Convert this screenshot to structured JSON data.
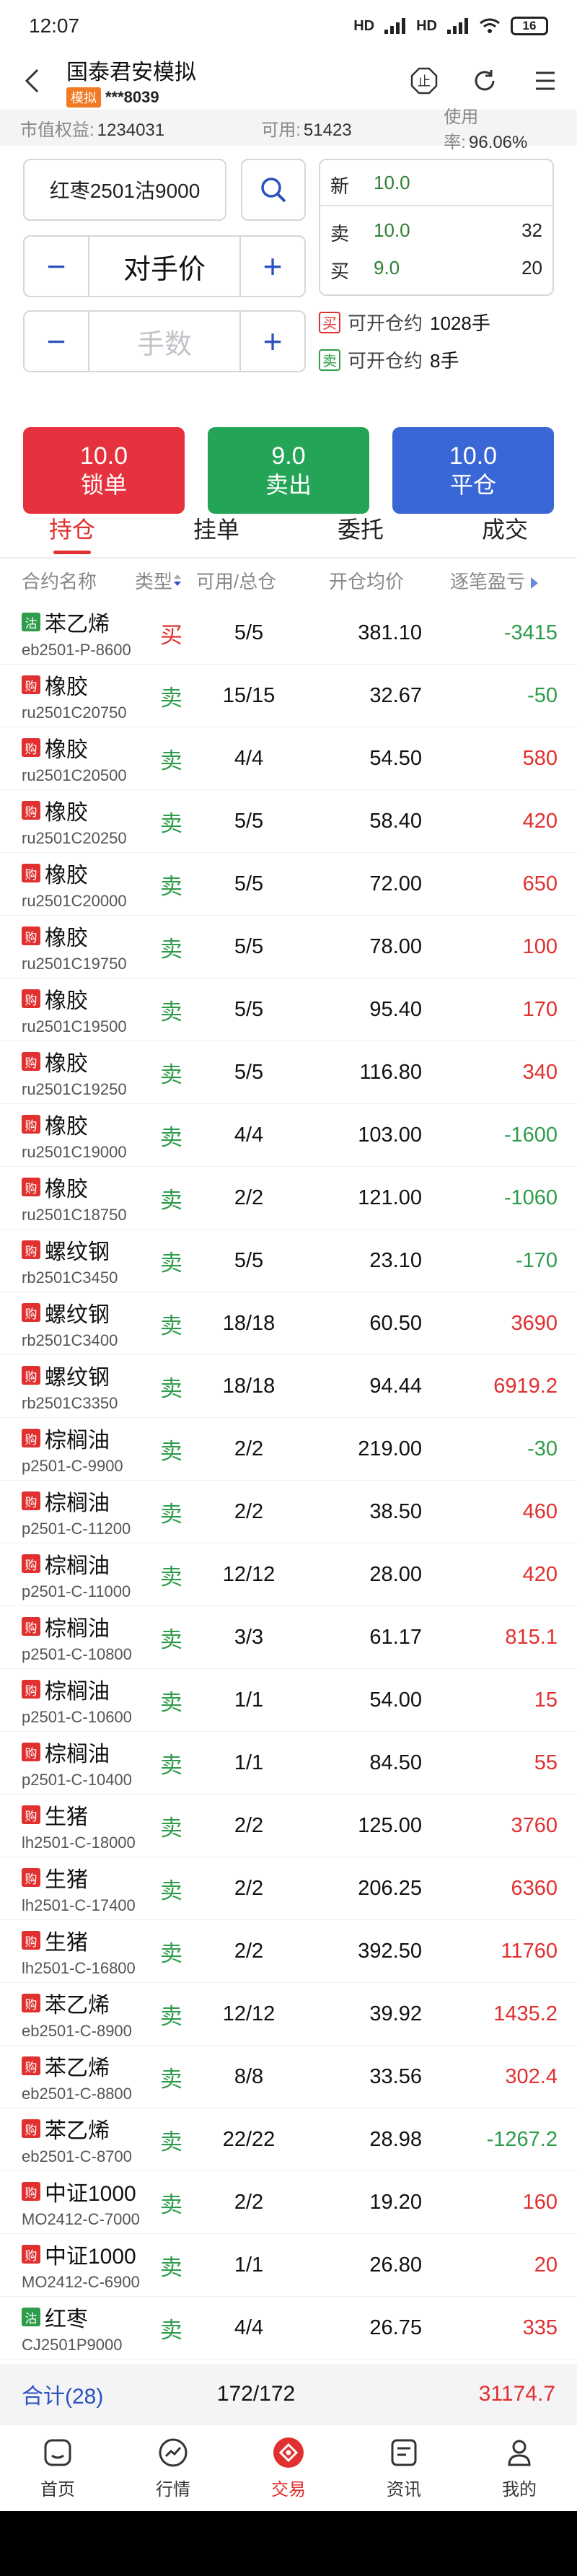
{
  "status": {
    "time": "12:07",
    "net1": "HD",
    "net2": "HD",
    "battery": "16"
  },
  "header": {
    "title": "国泰君安模拟",
    "tag": "模拟",
    "account": "***8039"
  },
  "summary": {
    "equity_label": "市值权益:",
    "equity_value": "1234031",
    "available_label": "可用:",
    "available_value": "51423",
    "usage_label": "使用率:",
    "usage_value": "96.06%"
  },
  "order": {
    "contract": "红枣2501沽9000",
    "price_mode": "对手价",
    "qty_placeholder": "手数",
    "minus": "−",
    "plus": "+"
  },
  "quote": {
    "last_label": "新",
    "last_price": "10.0",
    "ask_label": "卖",
    "ask_price": "10.0",
    "ask_vol": "32",
    "bid_label": "买",
    "bid_price": "9.0",
    "bid_vol": "20"
  },
  "open_info": {
    "buy_tag": "买",
    "buy_label": "可开仓约",
    "buy_value": "1028手",
    "sell_tag": "卖",
    "sell_label": "可开仓约",
    "sell_value": "8手"
  },
  "actions": [
    {
      "price": "10.0",
      "label": "锁单",
      "color": "#e5323e"
    },
    {
      "price": "9.0",
      "label": "卖出",
      "color": "#23a457"
    },
    {
      "price": "10.0",
      "label": "平仓",
      "color": "#3a67d6"
    }
  ],
  "tabs": [
    "持仓",
    "挂单",
    "委托",
    "成交"
  ],
  "columns": {
    "name": "合约名称",
    "type": "类型",
    "avail": "可用/总仓",
    "price": "开仓均价",
    "pnl": "逐笔盈亏"
  },
  "rows": [
    {
      "badge": "沽",
      "name": "苯乙烯",
      "code": "eb2501-P-8600",
      "type": "买",
      "avail": "5/5",
      "price": "381.10",
      "pnl": "-3415"
    },
    {
      "badge": "购",
      "name": "橡胶",
      "code": "ru2501C20750",
      "type": "卖",
      "avail": "15/15",
      "price": "32.67",
      "pnl": "-50"
    },
    {
      "badge": "购",
      "name": "橡胶",
      "code": "ru2501C20500",
      "type": "卖",
      "avail": "4/4",
      "price": "54.50",
      "pnl": "580"
    },
    {
      "badge": "购",
      "name": "橡胶",
      "code": "ru2501C20250",
      "type": "卖",
      "avail": "5/5",
      "price": "58.40",
      "pnl": "420"
    },
    {
      "badge": "购",
      "name": "橡胶",
      "code": "ru2501C20000",
      "type": "卖",
      "avail": "5/5",
      "price": "72.00",
      "pnl": "650"
    },
    {
      "badge": "购",
      "name": "橡胶",
      "code": "ru2501C19750",
      "type": "卖",
      "avail": "5/5",
      "price": "78.00",
      "pnl": "100"
    },
    {
      "badge": "购",
      "name": "橡胶",
      "code": "ru2501C19500",
      "type": "卖",
      "avail": "5/5",
      "price": "95.40",
      "pnl": "170"
    },
    {
      "badge": "购",
      "name": "橡胶",
      "code": "ru2501C19250",
      "type": "卖",
      "avail": "5/5",
      "price": "116.80",
      "pnl": "340"
    },
    {
      "badge": "购",
      "name": "橡胶",
      "code": "ru2501C19000",
      "type": "卖",
      "avail": "4/4",
      "price": "103.00",
      "pnl": "-1600"
    },
    {
      "badge": "购",
      "name": "橡胶",
      "code": "ru2501C18750",
      "type": "卖",
      "avail": "2/2",
      "price": "121.00",
      "pnl": "-1060"
    },
    {
      "badge": "购",
      "name": "螺纹钢",
      "code": "rb2501C3450",
      "type": "卖",
      "avail": "5/5",
      "price": "23.10",
      "pnl": "-170"
    },
    {
      "badge": "购",
      "name": "螺纹钢",
      "code": "rb2501C3400",
      "type": "卖",
      "avail": "18/18",
      "price": "60.50",
      "pnl": "3690"
    },
    {
      "badge": "购",
      "name": "螺纹钢",
      "code": "rb2501C3350",
      "type": "卖",
      "avail": "18/18",
      "price": "94.44",
      "pnl": "6919.2"
    },
    {
      "badge": "购",
      "name": "棕榈油",
      "code": "p2501-C-9900",
      "type": "卖",
      "avail": "2/2",
      "price": "219.00",
      "pnl": "-30"
    },
    {
      "badge": "购",
      "name": "棕榈油",
      "code": "p2501-C-11200",
      "type": "卖",
      "avail": "2/2",
      "price": "38.50",
      "pnl": "460"
    },
    {
      "badge": "购",
      "name": "棕榈油",
      "code": "p2501-C-11000",
      "type": "卖",
      "avail": "12/12",
      "price": "28.00",
      "pnl": "420"
    },
    {
      "badge": "购",
      "name": "棕榈油",
      "code": "p2501-C-10800",
      "type": "卖",
      "avail": "3/3",
      "price": "61.17",
      "pnl": "815.1"
    },
    {
      "badge": "购",
      "name": "棕榈油",
      "code": "p2501-C-10600",
      "type": "卖",
      "avail": "1/1",
      "price": "54.00",
      "pnl": "15"
    },
    {
      "badge": "购",
      "name": "棕榈油",
      "code": "p2501-C-10400",
      "type": "卖",
      "avail": "1/1",
      "price": "84.50",
      "pnl": "55"
    },
    {
      "badge": "购",
      "name": "生猪",
      "code": "lh2501-C-18000",
      "type": "卖",
      "avail": "2/2",
      "price": "125.00",
      "pnl": "3760"
    },
    {
      "badge": "购",
      "name": "生猪",
      "code": "lh2501-C-17400",
      "type": "卖",
      "avail": "2/2",
      "price": "206.25",
      "pnl": "6360"
    },
    {
      "badge": "购",
      "name": "生猪",
      "code": "lh2501-C-16800",
      "type": "卖",
      "avail": "2/2",
      "price": "392.50",
      "pnl": "11760"
    },
    {
      "badge": "购",
      "name": "苯乙烯",
      "code": "eb2501-C-8900",
      "type": "卖",
      "avail": "12/12",
      "price": "39.92",
      "pnl": "1435.2"
    },
    {
      "badge": "购",
      "name": "苯乙烯",
      "code": "eb2501-C-8800",
      "type": "卖",
      "avail": "8/8",
      "price": "33.56",
      "pnl": "302.4"
    },
    {
      "badge": "购",
      "name": "苯乙烯",
      "code": "eb2501-C-8700",
      "type": "卖",
      "avail": "22/22",
      "price": "28.98",
      "pnl": "-1267.2"
    },
    {
      "badge": "购",
      "name": "中证1000",
      "code": "MO2412-C-7000",
      "type": "卖",
      "avail": "2/2",
      "price": "19.20",
      "pnl": "160"
    },
    {
      "badge": "购",
      "name": "中证1000",
      "code": "MO2412-C-6900",
      "type": "卖",
      "avail": "1/1",
      "price": "26.80",
      "pnl": "20"
    },
    {
      "badge": "沽",
      "name": "红枣",
      "code": "CJ2501P9000",
      "type": "卖",
      "avail": "4/4",
      "price": "26.75",
      "pnl": "335"
    }
  ],
  "total": {
    "label": "合计(28)",
    "avail": "172/172",
    "pnl": "31174.7"
  },
  "nav": [
    {
      "label": "首页",
      "icon": "home-icon"
    },
    {
      "label": "行情",
      "icon": "market-icon"
    },
    {
      "label": "交易",
      "icon": "trade-icon"
    },
    {
      "label": "资讯",
      "icon": "news-icon"
    },
    {
      "label": "我的",
      "icon": "profile-icon"
    }
  ]
}
